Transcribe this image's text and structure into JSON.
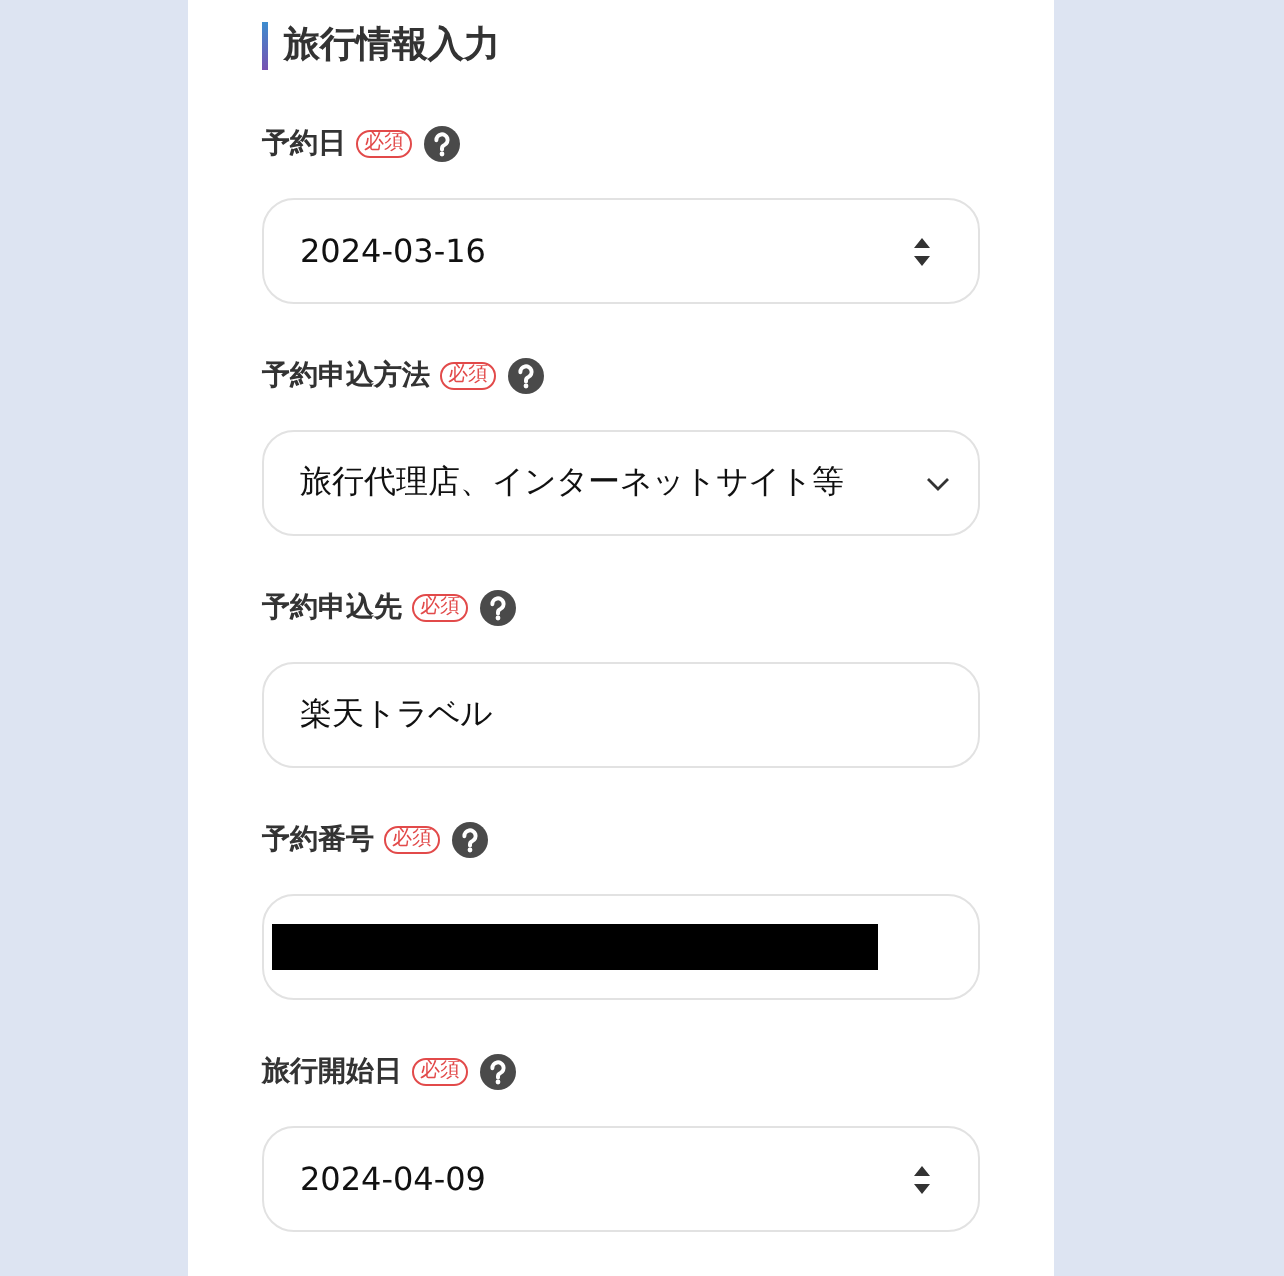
{
  "section_title": "旅行情報入力",
  "fields": [
    {
      "label": "予約日",
      "required_badge": "必須",
      "kind": "date",
      "value": "2024-03-16"
    },
    {
      "label": "予約申込方法",
      "required_badge": "必須",
      "kind": "select",
      "value": "旅行代理店、インターネットサイト等"
    },
    {
      "label": "予約申込先",
      "required_badge": "必須",
      "kind": "text",
      "value": "楽天トラベル"
    },
    {
      "label": "予約番号",
      "required_badge": "必須",
      "kind": "redacted"
    },
    {
      "label": "旅行開始日",
      "required_badge": "必須",
      "kind": "date",
      "value": "2024-04-09"
    }
  ]
}
